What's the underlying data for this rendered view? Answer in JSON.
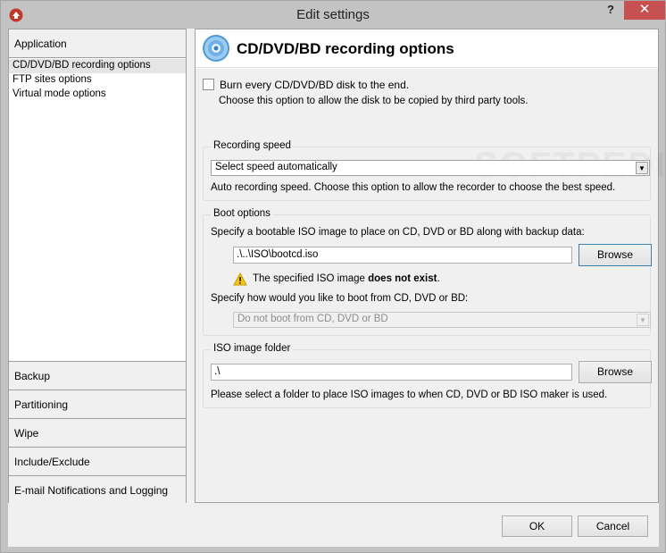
{
  "window": {
    "title": "Edit settings",
    "help_label": "?",
    "close_label": "✕"
  },
  "nav": {
    "top_group": "Application",
    "items": [
      "CD/DVD/BD recording options",
      "FTP sites options",
      "Virtual mode options"
    ],
    "lower_groups": [
      "Backup",
      "Partitioning",
      "Wipe",
      "Include/Exclude",
      "E-mail Notifications and Logging"
    ]
  },
  "panel": {
    "title": "CD/DVD/BD recording options",
    "burn_checkbox": {
      "label": "Burn every CD/DVD/BD disk to the end.",
      "checked": false
    },
    "burn_hint": "Choose this option to allow the disk to be copied by third party tools.",
    "recording_speed": {
      "legend": "Recording speed",
      "selected": "Select speed automatically",
      "hint": "Auto recording speed. Choose this option to allow the recorder to choose the best speed."
    },
    "boot": {
      "legend": "Boot options",
      "prompt": "Specify a bootable ISO image to place on CD, DVD or BD along with backup data:",
      "path_value": ".\\..\\ISO\\bootcd.iso",
      "browse": "Browse",
      "warning_pre": "The specified ISO image ",
      "warning_bold": "does not exist",
      "warning_post": ".",
      "boot_prompt": "Specify how would you like to boot from CD, DVD or BD:",
      "boot_selected": "Do not boot from CD, DVD or BD"
    },
    "iso": {
      "legend": "ISO image folder",
      "path_value": ".\\",
      "browse": "Browse",
      "hint": "Please select a folder to place ISO images to when CD, DVD or BD ISO maker is used."
    }
  },
  "footer": {
    "ok": "OK",
    "cancel": "Cancel"
  },
  "colors": {
    "close_button": "#c75050",
    "window_frame": "#c3c3c3",
    "accent": "#3c7fb1"
  }
}
